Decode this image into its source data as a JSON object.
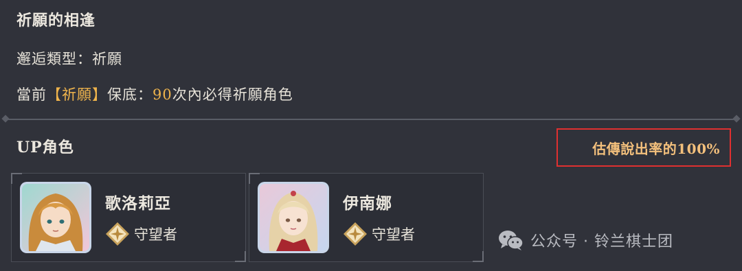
{
  "header": {
    "title": "祈願的相逢"
  },
  "encounter": {
    "label": "邂逅類型：",
    "value": "祈願"
  },
  "guarantee": {
    "prefix": "當前",
    "tag": "【祈願】",
    "mid": "保底：",
    "count": "90",
    "suffix": "次內必得祈願角色"
  },
  "up_section": {
    "title": "UP角色",
    "rate_label": "估傳說出率的100%"
  },
  "characters": [
    {
      "name": "歌洛莉亞",
      "role": "守望者",
      "role_icon": "star-badge-icon"
    },
    {
      "name": "伊南娜",
      "role": "守望者",
      "role_icon": "star-badge-icon"
    }
  ],
  "watermark": {
    "text": "公众号 · 铃兰棋士团",
    "icon": "wechat-icon"
  },
  "colors": {
    "background": "#30323a",
    "accent_gold": "#efb44c",
    "highlight_box": "#e03030",
    "rate_text": "#f3c07c"
  }
}
